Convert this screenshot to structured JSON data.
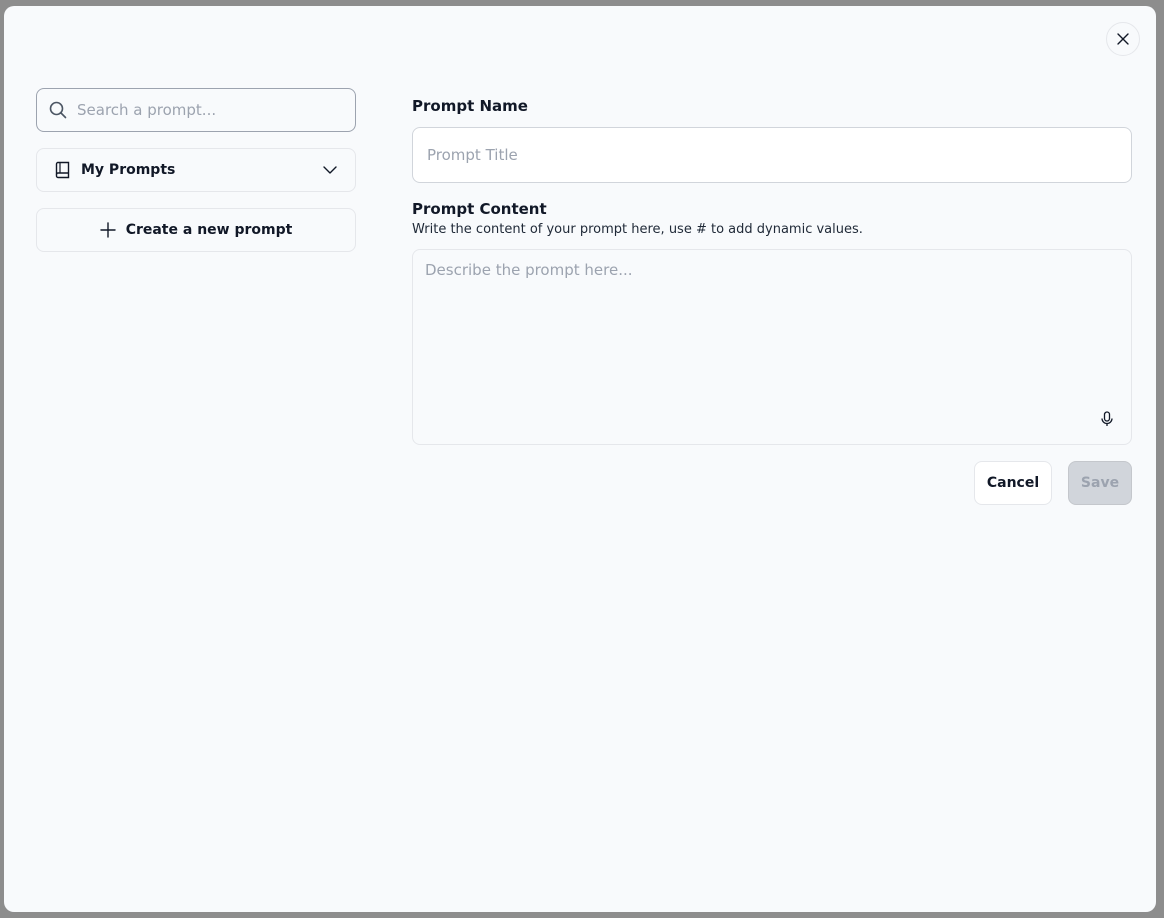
{
  "sidebar": {
    "search": {
      "placeholder": "Search a prompt...",
      "value": ""
    },
    "folder": {
      "label": "My Prompts",
      "icon": "book-icon"
    },
    "new_prompt": {
      "label": "Create a new prompt",
      "icon": "plus-icon"
    }
  },
  "form": {
    "name_label": "Prompt Name",
    "name_placeholder": "Prompt Title",
    "content_label": "Prompt Content",
    "content_help": "Write the content of your prompt here, use # to add dynamic values.",
    "content_placeholder": "Describe the prompt here..."
  },
  "actions": {
    "cancel_label": "Cancel",
    "save_label": "Save"
  },
  "colors": {
    "modal_bg": "#f8fafc",
    "overlay": "#8d8d8d",
    "disabled_button": "#d1d5db"
  }
}
